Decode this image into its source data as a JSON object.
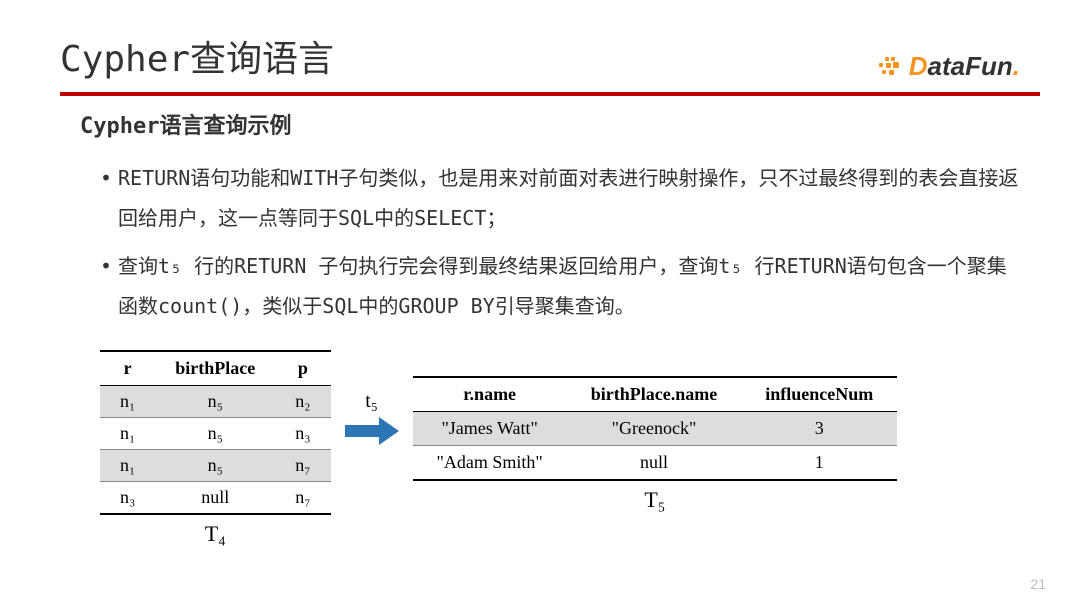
{
  "header": {
    "title": "Cypher查询语言",
    "logo_d": "D",
    "logo_rest": "ataFun",
    "logo_dot": "."
  },
  "subtitle": "Cypher语言查询示例",
  "bullets": [
    "RETURN语句功能和WITH子句类似，也是用来对前面对表进行映射操作，只不过最终得到的表会直接返回给用户，这一点等同于SQL中的SELECT；",
    "查询t₅ 行的RETURN 子句执行完会得到最终结果返回给用户，查询t₅ 行RETURN语句包含一个聚集函数count()，类似于SQL中的GROUP BY引导聚集查询。"
  ],
  "arrow_label": "t₅",
  "table1": {
    "headers": [
      "r",
      "birthPlace",
      "p"
    ],
    "rows": [
      [
        "n₁",
        "n₅",
        "n₂"
      ],
      [
        "n₁",
        "n₅",
        "n₃"
      ],
      [
        "n₁",
        "n₅",
        "n₇"
      ],
      [
        "n₃",
        "null",
        "n₇"
      ]
    ],
    "caption": "T₄"
  },
  "table2": {
    "headers": [
      "r.name",
      "birthPlace.name",
      "influenceNum"
    ],
    "rows": [
      [
        "\"James Watt\"",
        "\"Greenock\"",
        "3"
      ],
      [
        "\"Adam Smith\"",
        "null",
        "1"
      ]
    ],
    "caption": "T₅"
  },
  "page_number": "21"
}
